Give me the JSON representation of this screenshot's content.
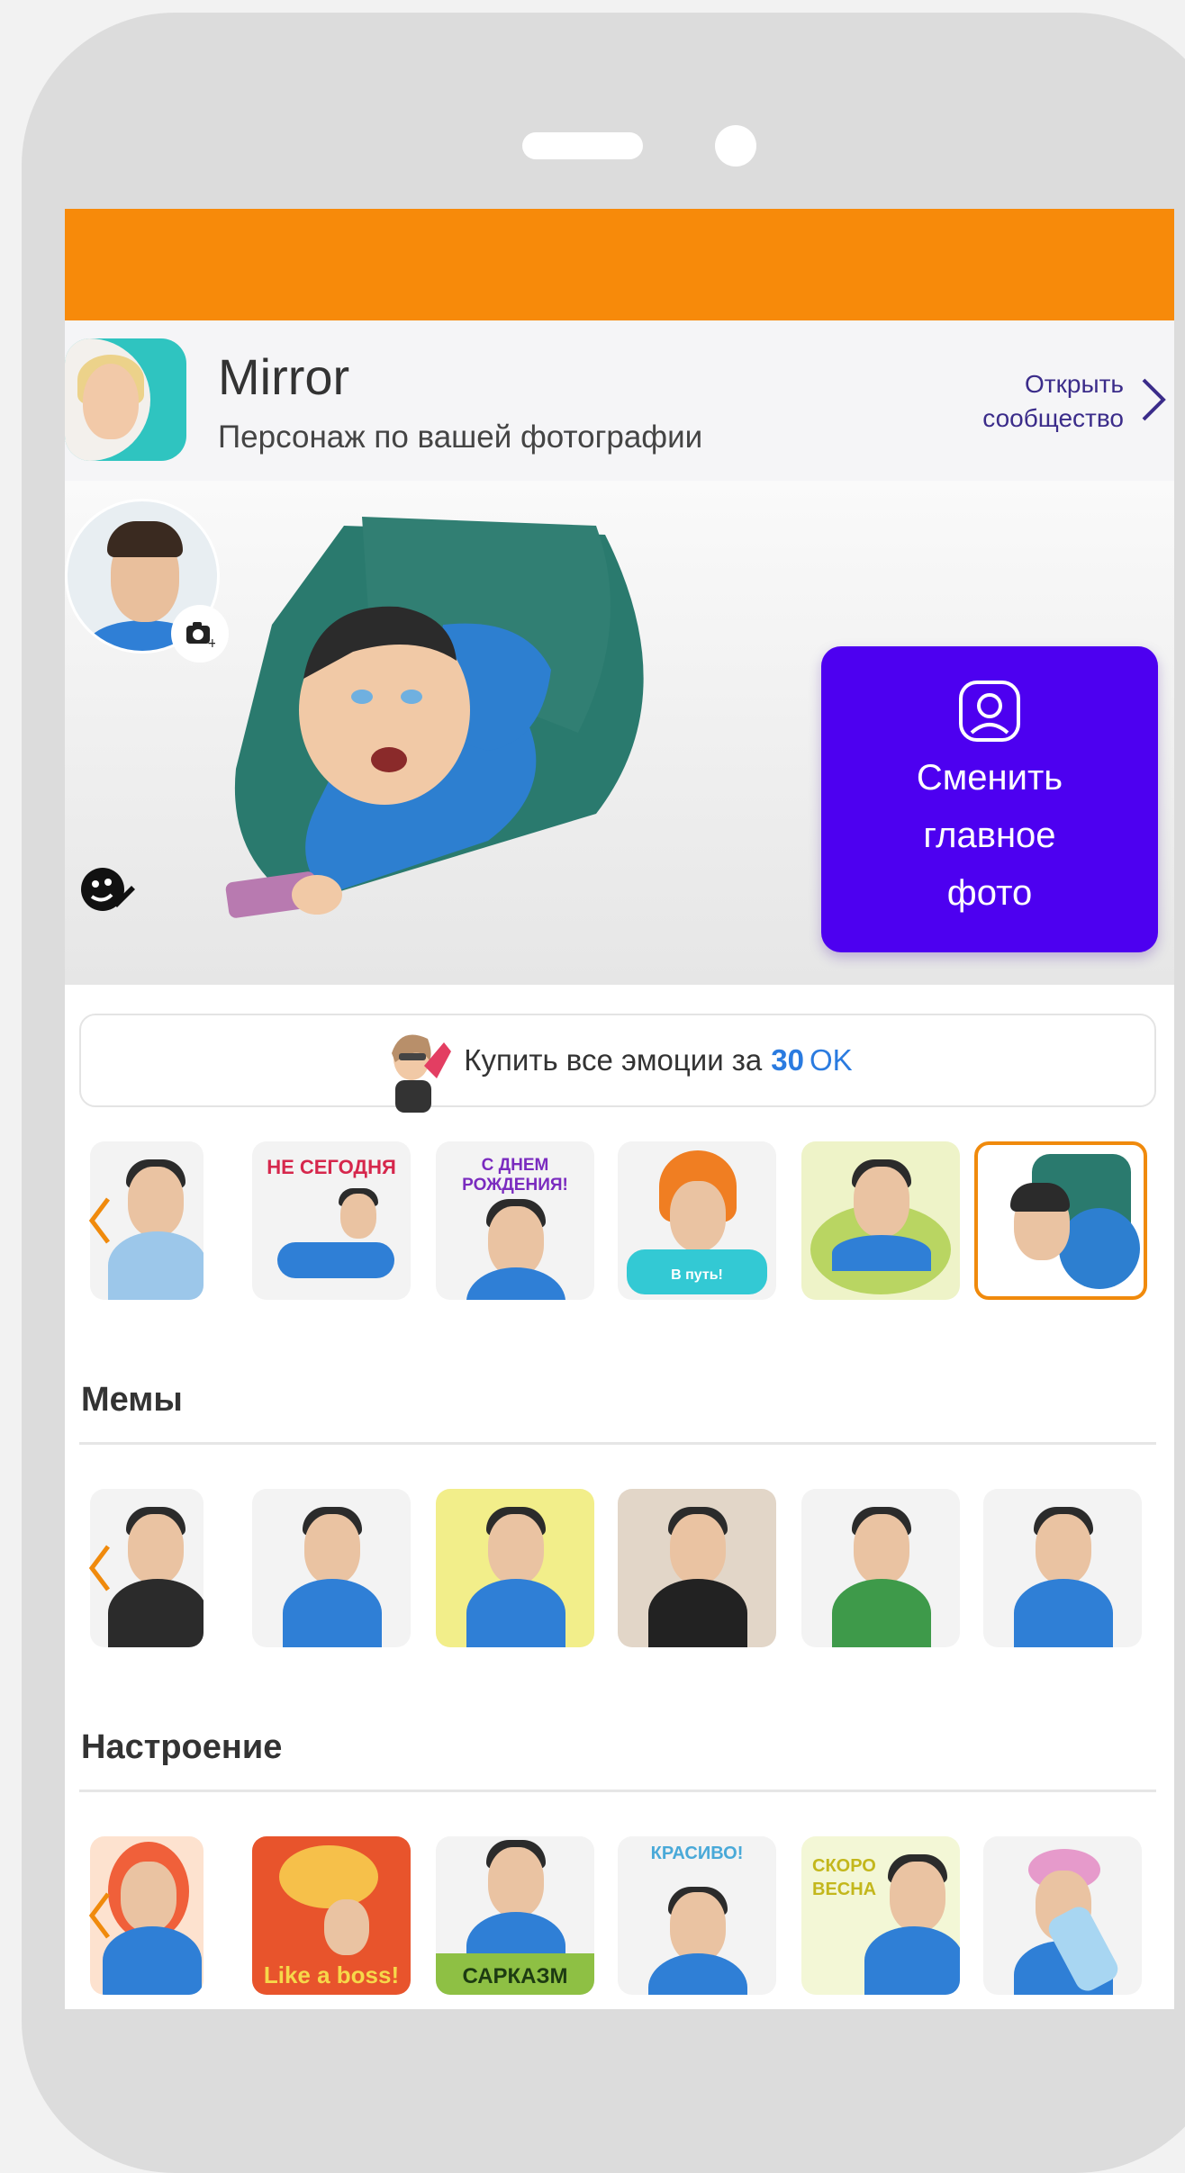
{
  "header": {
    "app_title": "Mirror",
    "app_subtitle": "Персонаж по вашей фотографии",
    "open_community_line1": "Открыть",
    "open_community_line2": "сообщество"
  },
  "hero": {
    "change_photo_line1": "Сменить",
    "change_photo_line2": "главное",
    "change_photo_line3": "фото"
  },
  "buy": {
    "label": "Купить все эмоции за",
    "price": "30",
    "currency": "OK"
  },
  "emotions_row": {
    "tiles": [
      {
        "caption": "",
        "top": ""
      },
      {
        "caption": "",
        "top": "НЕ СЕГОДНЯ"
      },
      {
        "caption": "",
        "top": "С ДНЕМ РОЖДЕНИЯ!"
      },
      {
        "caption": "В путь!",
        "top": ""
      },
      {
        "caption": "",
        "top": ""
      },
      {
        "caption": "",
        "top": ""
      }
    ]
  },
  "sections": {
    "memes_title": "Мемы",
    "mood_title": "Настроение"
  },
  "mood_row": {
    "tiles": [
      {
        "caption": "",
        "top": ""
      },
      {
        "caption": "Like a boss!",
        "top": ""
      },
      {
        "caption": "САРКАЗМ",
        "top": ""
      },
      {
        "caption": "",
        "top": "КРАСИВО!"
      },
      {
        "caption": "",
        "top": "СКОРО ВЕСНА"
      },
      {
        "caption": "",
        "top": ""
      }
    ]
  },
  "colors": {
    "status_bar": "#f78a0a",
    "primary_button": "#4d00f0",
    "accent_blue": "#2a7be0",
    "selected_border": "#f08a0c"
  }
}
